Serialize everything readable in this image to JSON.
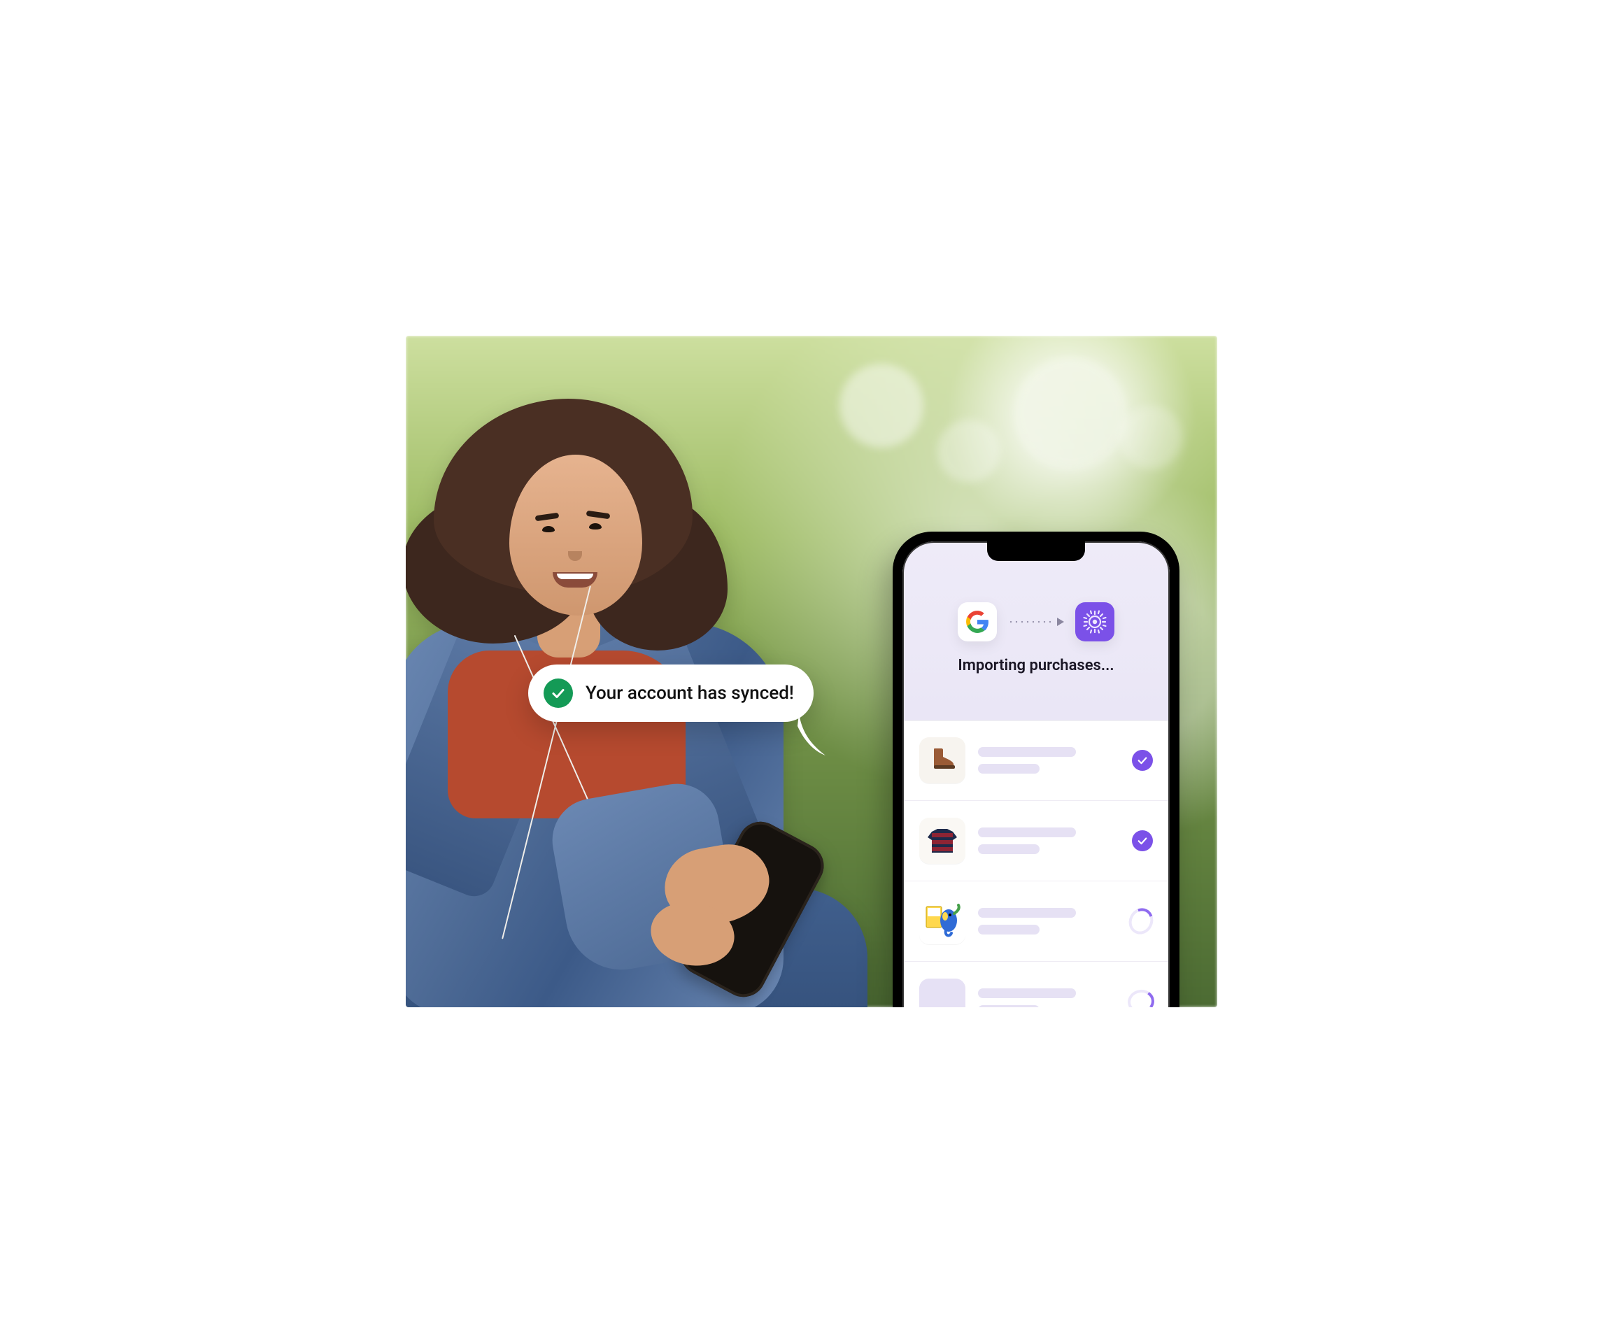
{
  "bubble": {
    "message": "Your account has synced!",
    "icon": "check-circle-icon"
  },
  "phone_app": {
    "header_title": "Importing purchases...",
    "source_app": "Google",
    "destination_app": "App",
    "items": [
      {
        "productKind": "boot",
        "status": "done"
      },
      {
        "productKind": "sweater",
        "status": "done"
      },
      {
        "productKind": "lego",
        "status": "loading"
      },
      {
        "productKind": "blank",
        "status": "loading"
      }
    ]
  },
  "colors": {
    "accent_purple": "#7b51e8",
    "success_green": "#149a56"
  }
}
